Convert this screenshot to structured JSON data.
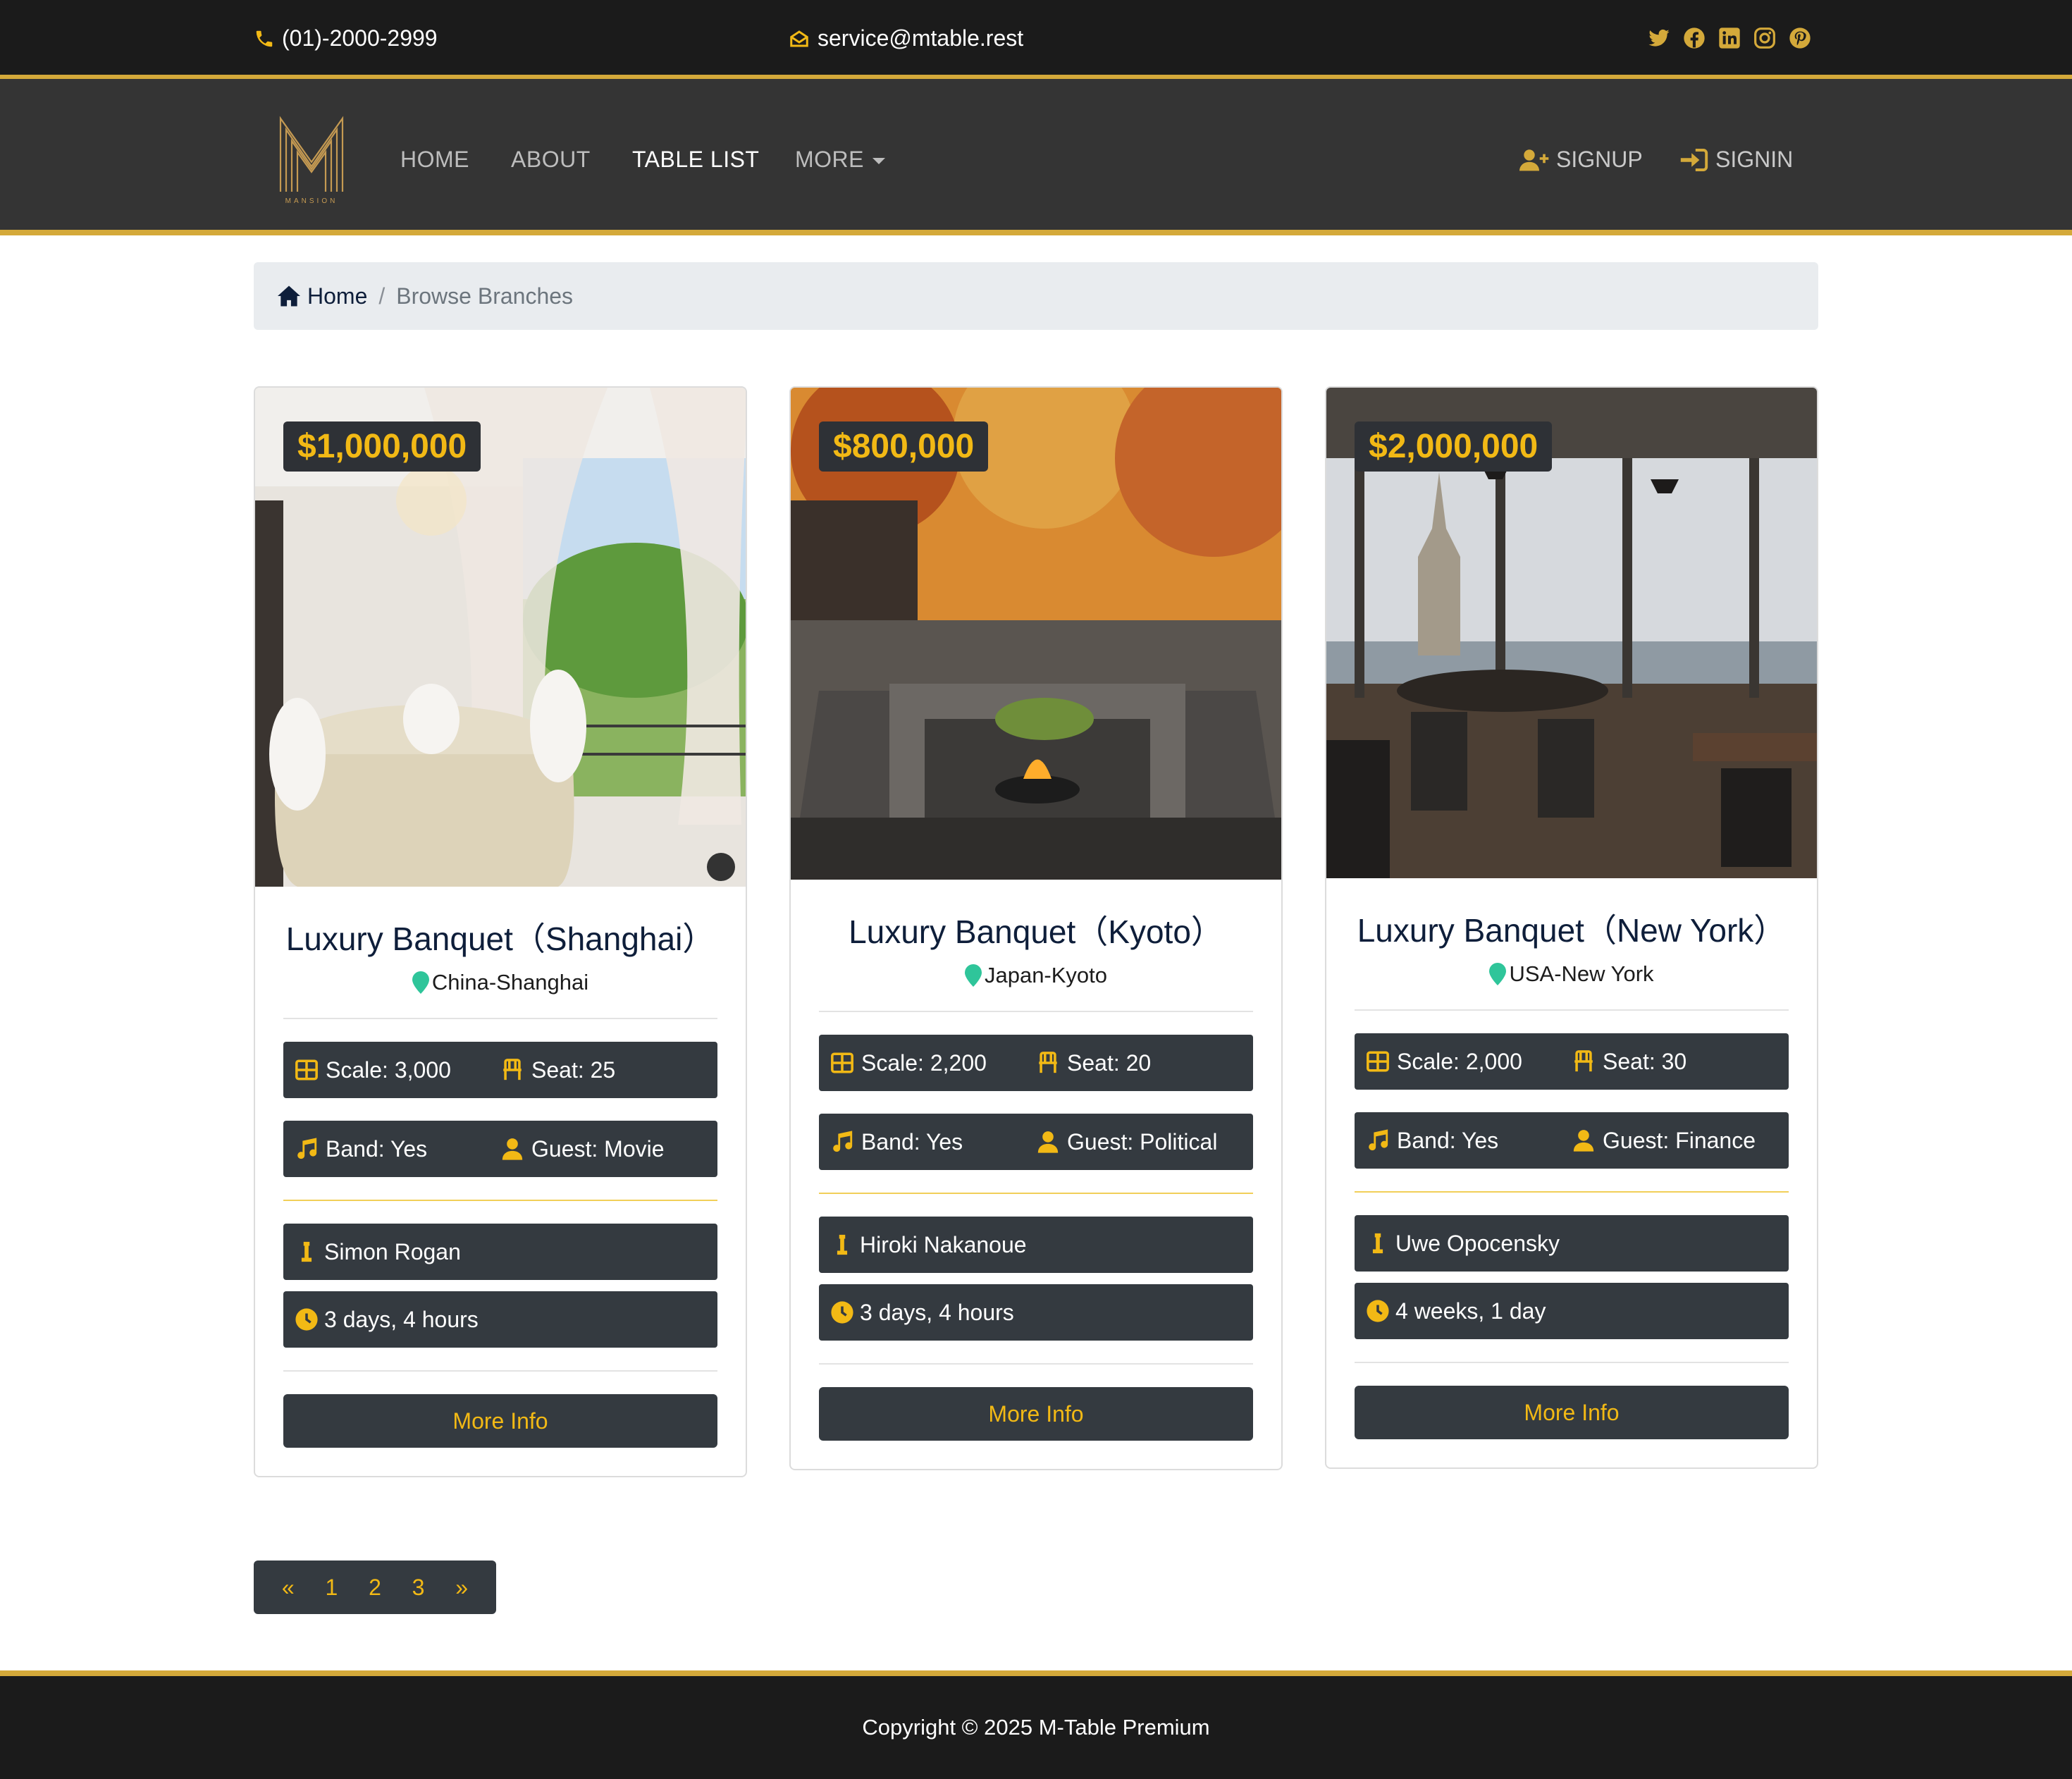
{
  "topbar": {
    "phone": "(01)-2000-2999",
    "email": "service@mtable.rest",
    "socials": [
      "twitter-icon",
      "facebook-icon",
      "linkedin-icon",
      "instagram-icon",
      "pinterest-icon"
    ]
  },
  "nav": {
    "logo_text": "MANSION",
    "home": "HOME",
    "about": "ABOUT",
    "table_list": "TABLE LIST",
    "more": "MORE",
    "signup": "SIGNUP",
    "signin": "SIGNIN"
  },
  "breadcrumb": {
    "home": "Home",
    "separator": "/",
    "current": "Browse Branches"
  },
  "cards": [
    {
      "price": "$1,000,000",
      "title": "Luxury Banquet（Shanghai）",
      "location": "China-Shanghai",
      "scale": "Scale: 3,000",
      "seat": "Seat: 25",
      "band": "Band: Yes",
      "guest": "Guest: Movie",
      "chef": "Simon Rogan",
      "time": "3 days, 4 hours",
      "button": "More Info"
    },
    {
      "price": "$800,000",
      "title": "Luxury Banquet（Kyoto）",
      "location": "Japan-Kyoto",
      "scale": "Scale: 2,200",
      "seat": "Seat: 20",
      "band": "Band: Yes",
      "guest": "Guest: Political",
      "chef": "Hiroki Nakanoue",
      "time": "3 days, 4 hours",
      "button": "More Info"
    },
    {
      "price": "$2,000,000",
      "title": "Luxury Banquet（New York）",
      "location": "USA-New York",
      "scale": "Scale: 2,000",
      "seat": "Seat: 30",
      "band": "Band: Yes",
      "guest": "Guest: Finance",
      "chef": "Uwe Opocensky",
      "time": "4 weeks, 1 day",
      "button": "More Info"
    }
  ],
  "pagination": {
    "prev": "«",
    "pages": [
      "1",
      "2",
      "3"
    ],
    "next": "»"
  },
  "footer": {
    "copyright": "Copyright © 2025 M-Table Premium"
  },
  "colors": {
    "gold": "#d4a93a",
    "accent_yellow": "#f2b915",
    "dark": "#343a40",
    "pin_green": "#2fc59a"
  }
}
